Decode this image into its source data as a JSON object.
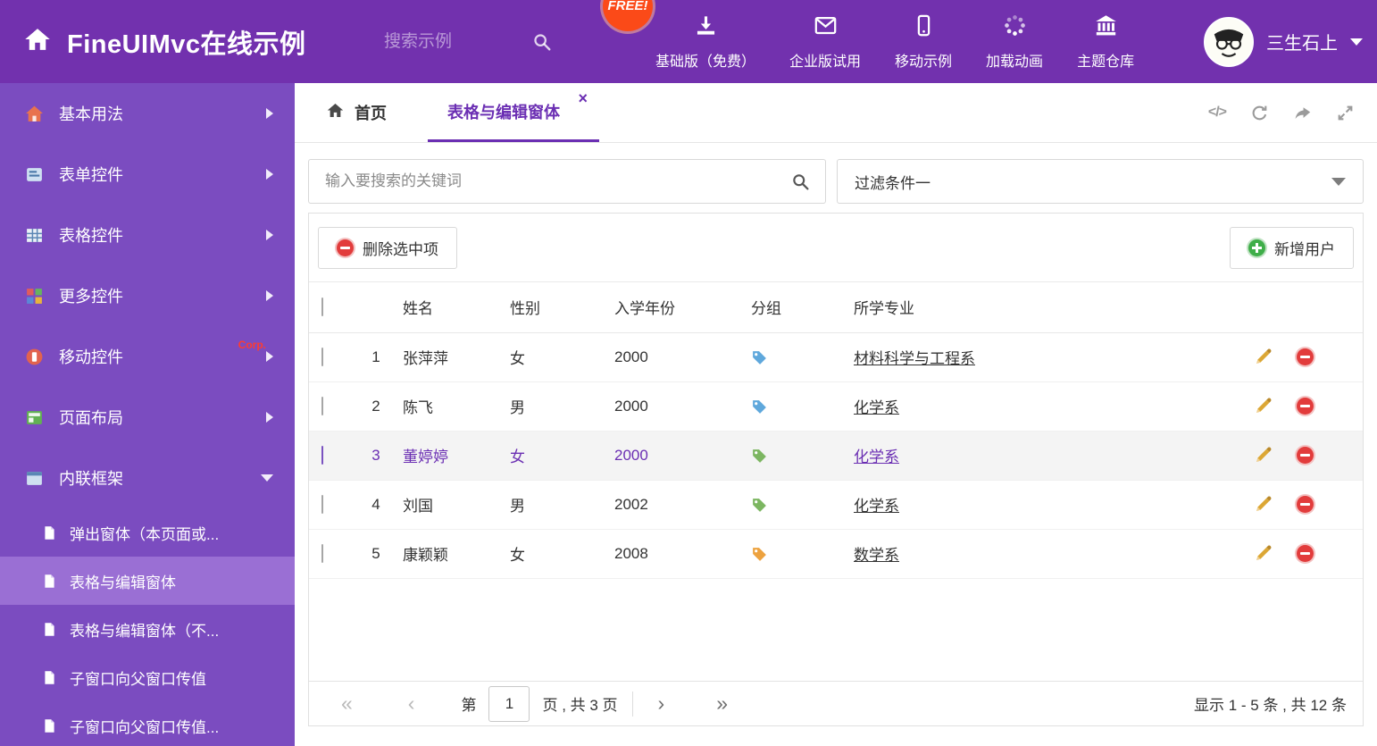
{
  "colors": {
    "accent": "#6b2fb3",
    "header_bg": "#7231ae",
    "sidebar_bg": "#7b4cc0",
    "sidebar_active_bg": "#9a6fd4",
    "free_badge_bg": "#fb4a18",
    "delete_red": "#e23c3c",
    "add_green": "#3fae49",
    "pencil_gold": "#dca735"
  },
  "header": {
    "title": "FineUIMvc在线示例",
    "search_placeholder": "搜索示例",
    "free_badge": "FREE!",
    "nav": [
      {
        "label": "基础版（免费）"
      },
      {
        "label": "企业版试用"
      },
      {
        "label": "移动示例"
      },
      {
        "label": "加载动画"
      },
      {
        "label": "主题仓库"
      }
    ],
    "user_name": "三生石上"
  },
  "sidebar": {
    "items": [
      {
        "label": "基本用法"
      },
      {
        "label": "表单控件"
      },
      {
        "label": "表格控件"
      },
      {
        "label": "更多控件"
      },
      {
        "label": "移动控件",
        "badge": "Corp."
      },
      {
        "label": "页面布局"
      },
      {
        "label": "内联框架",
        "expanded": true
      }
    ],
    "subitems": [
      {
        "label": "弹出窗体（本页面或..."
      },
      {
        "label": "表格与编辑窗体",
        "active": true
      },
      {
        "label": "表格与编辑窗体（不..."
      },
      {
        "label": "子窗口向父窗口传值"
      },
      {
        "label": "子窗口向父窗口传值..."
      }
    ]
  },
  "tabs": {
    "home_label": "首页",
    "active_label": "表格与编辑窗体",
    "close_glyph": "×"
  },
  "icons": {
    "code_glyph": "</>"
  },
  "filters": {
    "search_placeholder": "输入要搜索的关键词",
    "filter_value": "过滤条件一"
  },
  "toolbar": {
    "delete_label": "删除选中项",
    "add_label": "新增用户"
  },
  "table": {
    "columns": [
      "姓名",
      "性别",
      "入学年份",
      "分组",
      "所学专业"
    ],
    "rows": [
      {
        "num": "1",
        "name": "张萍萍",
        "gender": "女",
        "year": "2000",
        "tag_color": "#5fa8dc",
        "major": "材料科学与工程系"
      },
      {
        "num": "2",
        "name": "陈飞",
        "gender": "男",
        "year": "2000",
        "tag_color": "#5fa8dc",
        "major": "化学系"
      },
      {
        "num": "3",
        "name": "董婷婷",
        "gender": "女",
        "year": "2000",
        "tag_color": "#7cb661",
        "major": "化学系",
        "selected": true
      },
      {
        "num": "4",
        "name": "刘国",
        "gender": "男",
        "year": "2002",
        "tag_color": "#7cb661",
        "major": "化学系"
      },
      {
        "num": "5",
        "name": "康颖颖",
        "gender": "女",
        "year": "2008",
        "tag_color": "#eda23f",
        "major": "数学系"
      }
    ]
  },
  "pagination": {
    "page_prefix": "第",
    "page_value": "1",
    "page_suffix": "页 , 共 3 页",
    "summary": "显示 1 - 5 条 , 共 12 条"
  }
}
